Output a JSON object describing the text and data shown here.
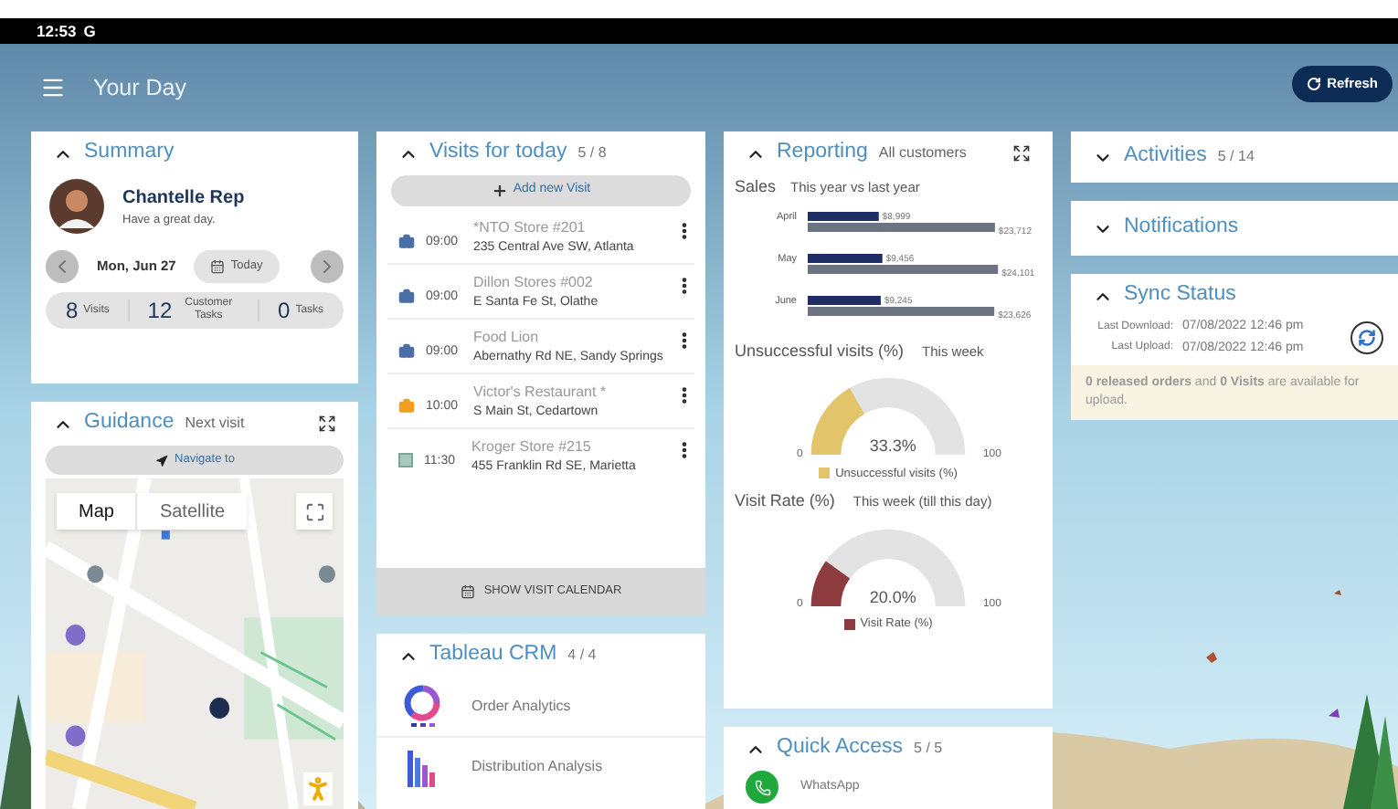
{
  "status_bar": {
    "time": "12:53",
    "carrier": "G"
  },
  "header": {
    "title": "Your Day",
    "refresh": "Refresh"
  },
  "summary": {
    "title": "Summary",
    "expanded": true,
    "name": "Chantelle Rep",
    "greeting": "Have a great day.",
    "date": "Mon, Jun 27",
    "today": "Today",
    "stats": [
      {
        "value": "8",
        "label": "Visits"
      },
      {
        "value": "12",
        "label": "Customer Tasks"
      },
      {
        "value": "0",
        "label": "Tasks"
      }
    ]
  },
  "guidance": {
    "title": "Guidance",
    "subtitle": "Next visit",
    "expanded": true,
    "navigate": "Navigate to",
    "map_types": [
      {
        "label": "Map",
        "selected": true
      },
      {
        "label": "Satellite",
        "selected": false
      }
    ]
  },
  "visits": {
    "title": "Visits for today",
    "count": "5 / 8",
    "expanded": true,
    "add": "Add new Visit",
    "items": [
      {
        "kind": "briefcase",
        "color": "#4a6fa5",
        "time": "09:00",
        "name": "*NTO Store #201",
        "address": "235 Central Ave SW, Atlanta"
      },
      {
        "kind": "briefcase",
        "color": "#4a6fa5",
        "time": "09:00",
        "name": "Dillon Stores #002",
        "address": "E Santa Fe St, Olathe"
      },
      {
        "kind": "briefcase",
        "color": "#4a6fa5",
        "time": "09:00",
        "name": "Food Lion",
        "address": "Abernathy Rd NE, Sandy Springs"
      },
      {
        "kind": "briefcase",
        "color": "#f0a020",
        "time": "10:00",
        "name": "Victor's Restaurant *",
        "address": "S Main St, Cedartown"
      },
      {
        "kind": "square",
        "color": "#a9c9bd",
        "time": "11:30",
        "name": "Kroger Store #215",
        "address": "455 Franklin Rd SE, Marietta"
      }
    ],
    "footer": "SHOW VISIT CALENDAR"
  },
  "tableau": {
    "title": "Tableau CRM",
    "count": "4 / 4",
    "expanded": true,
    "items": [
      {
        "kind": "donut",
        "label": "Order Analytics"
      },
      {
        "kind": "bars",
        "label": "Distribution Analysis"
      }
    ]
  },
  "reporting": {
    "title": "Reporting",
    "subtitle": "All customers",
    "expanded": true,
    "sales": {
      "label": "Sales",
      "period": "This year vs last year",
      "chart_data": {
        "type": "bar",
        "orientation": "horizontal",
        "categories": [
          "April",
          "May",
          "June"
        ],
        "series": [
          {
            "color": "#1f2d66",
            "values": [
              8999,
              9456,
              9245
            ],
            "value_labels": [
              "$8,999",
              "$9,456",
              "$9,245"
            ]
          },
          {
            "color": "#6b7480",
            "values": [
              23712,
              24101,
              23626
            ],
            "value_labels": [
              "$23,712",
              "$24,101",
              "$23,626"
            ]
          }
        ]
      }
    },
    "gauges": [
      {
        "title": "Unsuccessful visits (%)",
        "period": "This week",
        "level": 0.333,
        "reading": "33.3%",
        "min": "0",
        "max": "100",
        "legend": "Unsuccessful visits (%)",
        "color": "#e2c46a"
      },
      {
        "title": "Visit Rate (%)",
        "period": "This week (till this day)",
        "level": 0.2,
        "reading": "20.0%",
        "min": "0",
        "max": "100",
        "legend": "Visit Rate (%)",
        "color": "#8e3b3f"
      }
    ]
  },
  "quick_access": {
    "title": "Quick Access",
    "count": "5 / 5",
    "expanded": true,
    "items": [
      {
        "label": "WhatsApp"
      }
    ]
  },
  "activities": {
    "title": "Activities",
    "count": "5 / 14",
    "expanded": false
  },
  "notifications": {
    "title": "Notifications",
    "expanded": false
  },
  "sync": {
    "title": "Sync Status",
    "expanded": true,
    "rows": [
      {
        "label": "Last Download:",
        "value": "07/08/2022 12:46 pm"
      },
      {
        "label": "Last Upload:",
        "value": "07/08/2022 12:46 pm"
      }
    ],
    "notice": "**0 released orders** and **0 Visits** are available for upload."
  }
}
